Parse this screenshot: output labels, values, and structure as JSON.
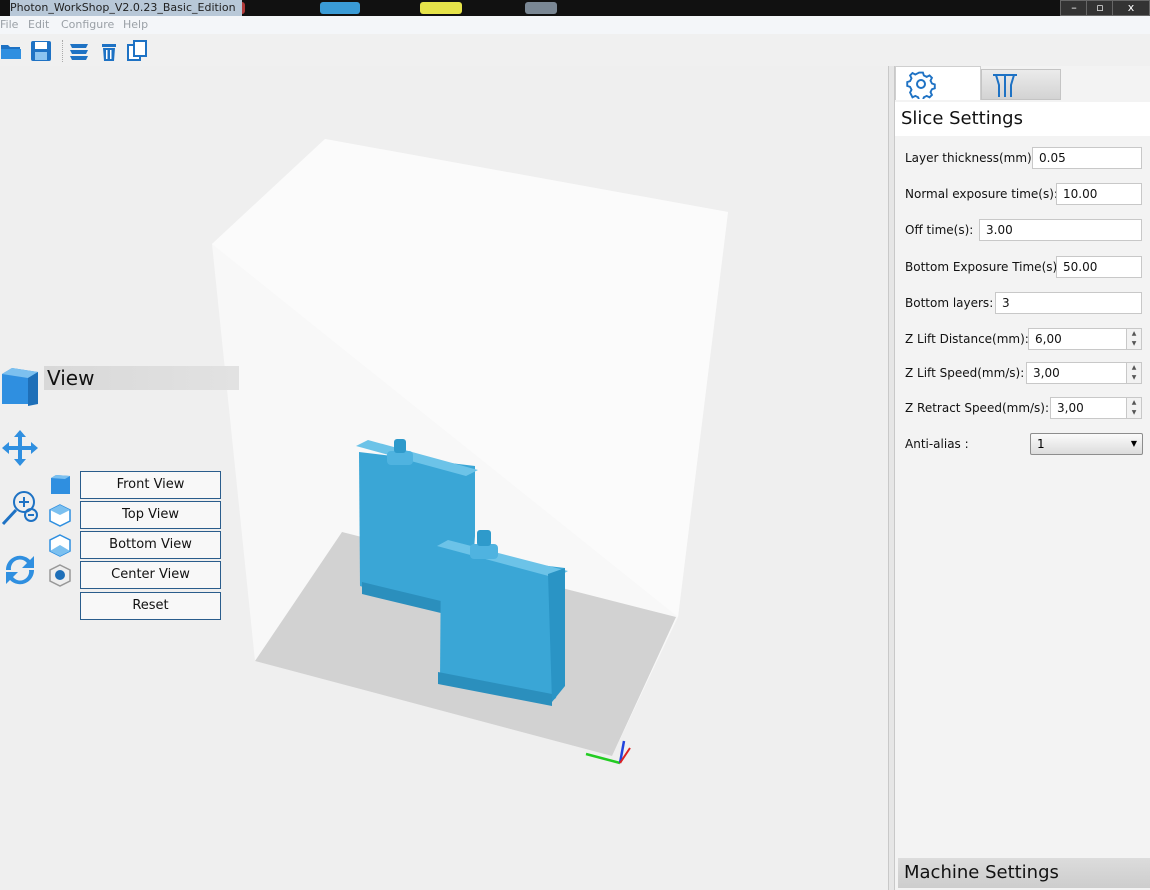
{
  "window": {
    "title": "Photon_WorkShop_V2.0.23_Basic_Edition",
    "minimize": "–",
    "restore": "▫",
    "close": "x"
  },
  "menu": {
    "items": [
      "File",
      "Edit",
      "Configure",
      "Help"
    ]
  },
  "view_panel": {
    "title": "View",
    "buttons": {
      "front": "Front View",
      "top": "Top View",
      "bottom": "Bottom View",
      "center": "Center View",
      "reset": "Reset"
    }
  },
  "panel": {
    "slice_title": "Slice Settings",
    "fields": {
      "layer_thickness": {
        "label": "Layer thickness(mm):",
        "value": "0.05"
      },
      "normal_exposure": {
        "label": "Normal exposure time(s):",
        "value": "10.00"
      },
      "off_time": {
        "label": "Off time(s):",
        "value": "3.00"
      },
      "bottom_exposure": {
        "label": "Bottom Exposure Time(s):",
        "value": "50.00"
      },
      "bottom_layers": {
        "label": "Bottom layers:",
        "value": "3"
      },
      "z_lift_distance": {
        "label": "Z Lift Distance(mm):",
        "value": "6,00"
      },
      "z_lift_speed": {
        "label": "Z Lift Speed(mm/s):",
        "value": "3,00"
      },
      "z_retract_speed": {
        "label": "Z Retract Speed(mm/s):",
        "value": "3,00"
      }
    },
    "anti_alias": {
      "label": "Anti-alias :",
      "value": "1"
    },
    "machine_title": "Machine Settings"
  },
  "colors": {
    "model": "#3aa6d6",
    "accent": "#2a5d8c",
    "background": "#efefef"
  }
}
